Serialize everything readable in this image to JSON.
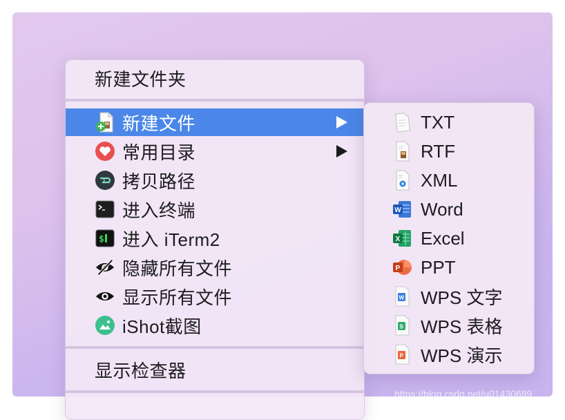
{
  "context_menu": {
    "items": [
      {
        "label": "新建文件夹"
      },
      {
        "label": "新建文件"
      },
      {
        "label": "常用目录"
      },
      {
        "label": "拷贝路径"
      },
      {
        "label": "进入终端"
      },
      {
        "label": "进入 iTerm2"
      },
      {
        "label": "隐藏所有文件"
      },
      {
        "label": "显示所有文件"
      },
      {
        "label": "iShot截图"
      },
      {
        "label": "显示检查器"
      }
    ],
    "selected_item": "新建文件",
    "selected_color": "#4a87e8"
  },
  "submenu": {
    "items": [
      {
        "label": "TXT",
        "icon": "txt-file-icon"
      },
      {
        "label": "RTF",
        "icon": "rtf-file-icon"
      },
      {
        "label": "XML",
        "icon": "xml-file-icon"
      },
      {
        "label": "Word",
        "icon": "word-icon"
      },
      {
        "label": "Excel",
        "icon": "excel-icon"
      },
      {
        "label": "PPT",
        "icon": "powerpoint-icon"
      },
      {
        "label": "WPS 文字",
        "icon": "wps-writer-icon"
      },
      {
        "label": "WPS 表格",
        "icon": "wps-spreadsheet-icon"
      },
      {
        "label": "WPS 演示",
        "icon": "wps-presentation-icon"
      }
    ]
  },
  "watermark": "https://blog.csdn.net/u01430689"
}
